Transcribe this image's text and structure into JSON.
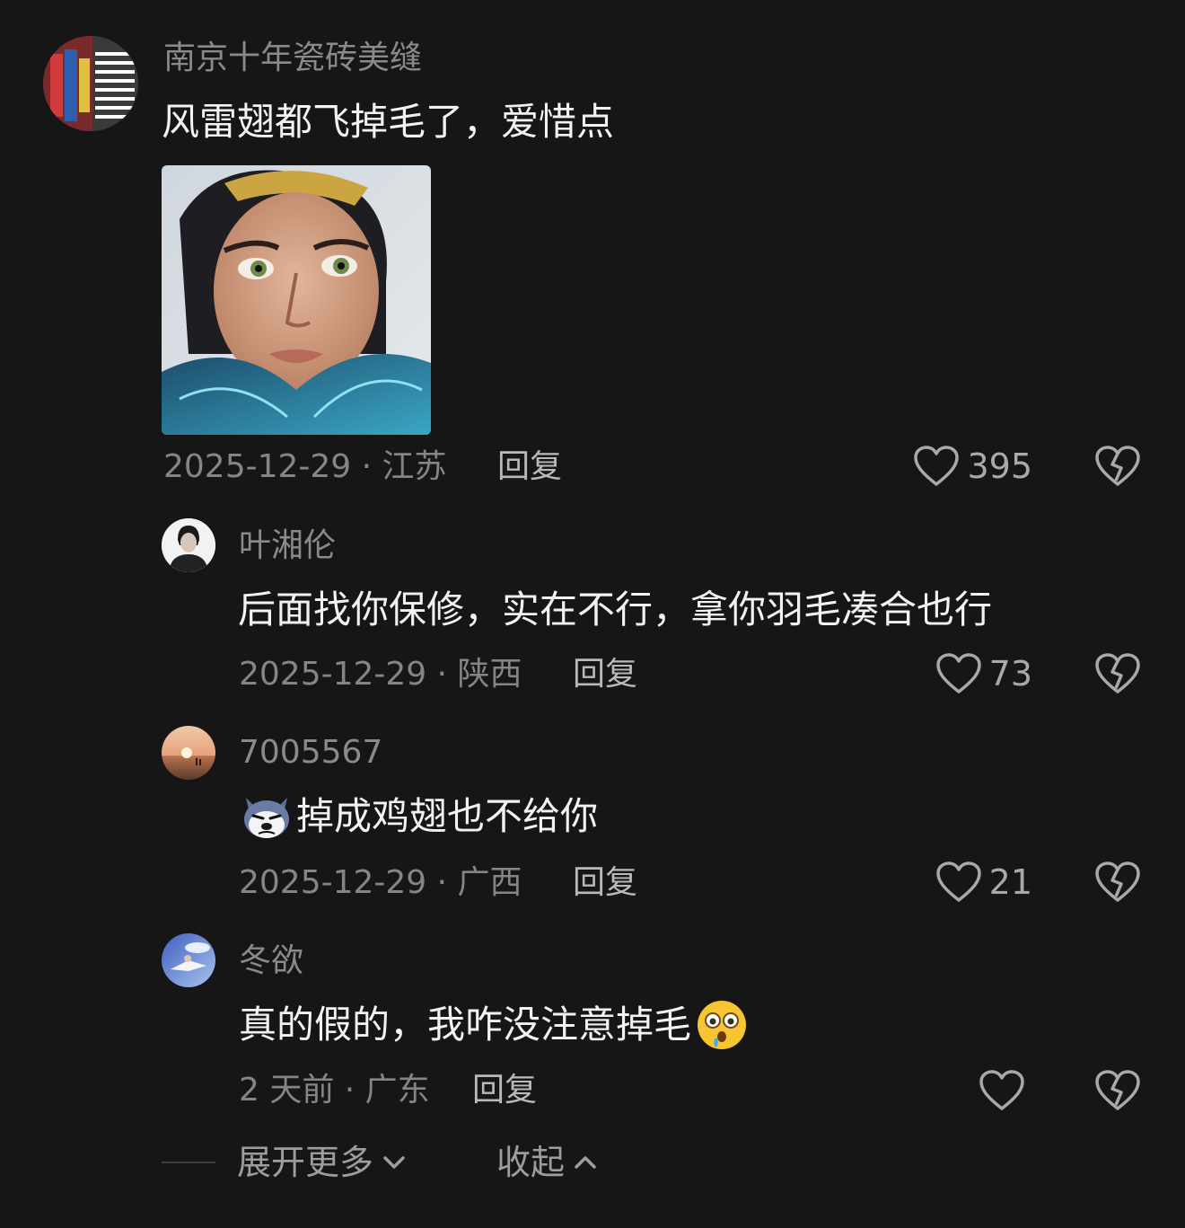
{
  "comments": [
    {
      "username": "南京十年瓷砖美缝",
      "text": "风雷翅都飞掉毛了，爱惜点",
      "date_location": "2025-12-29 · 江苏",
      "reply_label": "回复",
      "likes": "395"
    },
    {
      "username": "叶湘伦",
      "text": "后面找你保修，实在不行，拿你羽毛凑合也行",
      "date_location": "2025-12-29 · 陕西",
      "reply_label": "回复",
      "likes": "73"
    },
    {
      "username": "7005567",
      "text": "掉成鸡翅也不给你",
      "date_location": "2025-12-29 · 广西",
      "reply_label": "回复",
      "likes": "21"
    },
    {
      "username": "冬欲",
      "text": "真的假的，我咋没注意掉毛",
      "date_location": "2 天前 · 广东",
      "reply_label": "回复",
      "likes": ""
    }
  ],
  "footer": {
    "expand_label": "展开更多",
    "collapse_label": "收起"
  },
  "colors": {
    "background": "#161616",
    "username": "#8a8a8a",
    "text": "#f2f2f2",
    "meta": "#858585"
  }
}
